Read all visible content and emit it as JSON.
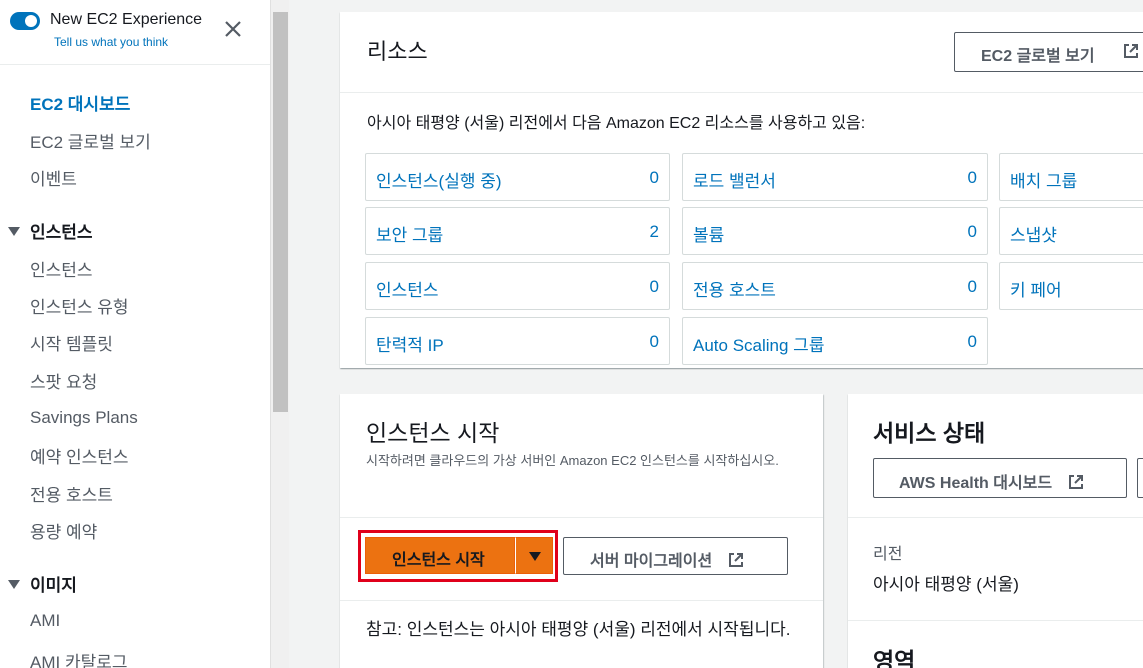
{
  "experience": {
    "title": "New EC2 Experience",
    "subtitle": "Tell us what you think",
    "enabled": true
  },
  "sidebar": {
    "items": [
      {
        "label": "EC2 대시보드",
        "active": true
      },
      {
        "label": "EC2 글로벌 보기"
      },
      {
        "label": "이벤트"
      }
    ],
    "sections": [
      {
        "label": "인스턴스",
        "items": [
          "인스턴스",
          "인스턴스 유형",
          "시작 템플릿",
          "스팟 요청",
          "Savings Plans",
          "예약 인스턴스",
          "전용 호스트",
          "용량 예약"
        ]
      },
      {
        "label": "이미지",
        "items": [
          "AMI",
          "AMI 카탈로그"
        ]
      }
    ]
  },
  "resources": {
    "title": "리소스",
    "global_button": "EC2 글로벌 보기",
    "description": "아시아 태평양 (서울) 리전에서 다음 Amazon EC2 리소스를 사용하고 있음:",
    "cells": [
      {
        "label": "인스턴스(실행 중)",
        "count": "0"
      },
      {
        "label": "로드 밸런서",
        "count": "0"
      },
      {
        "label": "배치 그룹",
        "count": ""
      },
      {
        "label": "보안 그룹",
        "count": "2"
      },
      {
        "label": "볼륨",
        "count": "0"
      },
      {
        "label": "스냅샷",
        "count": ""
      },
      {
        "label": "인스턴스",
        "count": "0"
      },
      {
        "label": "전용 호스트",
        "count": "0"
      },
      {
        "label": "키 페어",
        "count": ""
      },
      {
        "label": "탄력적 IP",
        "count": "0"
      },
      {
        "label": "Auto Scaling 그룹",
        "count": "0"
      }
    ]
  },
  "launch": {
    "title": "인스턴스 시작",
    "description": "시작하려면 클라우드의 가상 서버인 Amazon EC2 인스턴스를 시작하십시오.",
    "launch_button": "인스턴스 시작",
    "migrate_button": "서버 마이그레이션",
    "note": "참고: 인스턴스는 아시아 태평양 (서울) 리전에서 시작됩니다."
  },
  "service_health": {
    "title": "서비스 상태",
    "health_button": "AWS Health 대시보드",
    "region_label": "리전",
    "region_value": "아시아 태평양 (서울)",
    "zones_title": "영역"
  },
  "colors": {
    "accent": "#0073bb",
    "primary_button": "#ec7211",
    "highlight": "#e0001b"
  }
}
